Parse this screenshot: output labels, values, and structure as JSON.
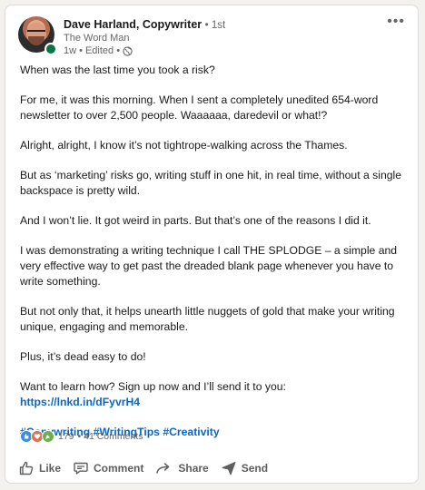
{
  "post": {
    "author": {
      "name": "Dave Harland, Copywriter",
      "degree": "• 1st",
      "headline": "The Word Man",
      "meta_time": "1w",
      "meta_edited": "• Edited •"
    },
    "more_icon": "more-horizontal-icon",
    "paragraphs": [
      "When was the last time you took a risk?",
      "For me, it was this morning. When I sent a completely unedited 654-word newsletter to over 2,500 people. Waaaaaa, daredevil or what!?",
      "Alright, alright, I know it’s not tightrope-walking across the Thames.",
      "But as ‘marketing’ risks go, writing stuff in one hit, in real time, without a single backspace is pretty wild.",
      "And I won’t lie. It got weird in parts. But that’s one of the reasons I did it.",
      "I was demonstrating a writing technique I call THE SPLODGE – a simple and very effective way to get past the dreaded blank page whenever you have to write something.",
      "But not only that, it helps unearth little nuggets of gold that make your writing unique, engaging and memorable.",
      "Plus, it’s dead easy to do!"
    ],
    "cta_text": "Want to learn how? Sign up now and I’ll send it to you: ",
    "cta_link": "https://lnkd.in/dFyvrH4",
    "hashtags": "#Copywriting #WritingTips #Creativity",
    "reaction_count": "179",
    "comments_label": "• 41 Comments",
    "actions": {
      "like": "Like",
      "comment": "Comment",
      "share": "Share",
      "send": "Send"
    }
  },
  "colors": {
    "link": "#0a66c2",
    "online": "#057642",
    "like": "#378fe9",
    "love": "#df704d",
    "celebrate": "#6dae4f"
  }
}
